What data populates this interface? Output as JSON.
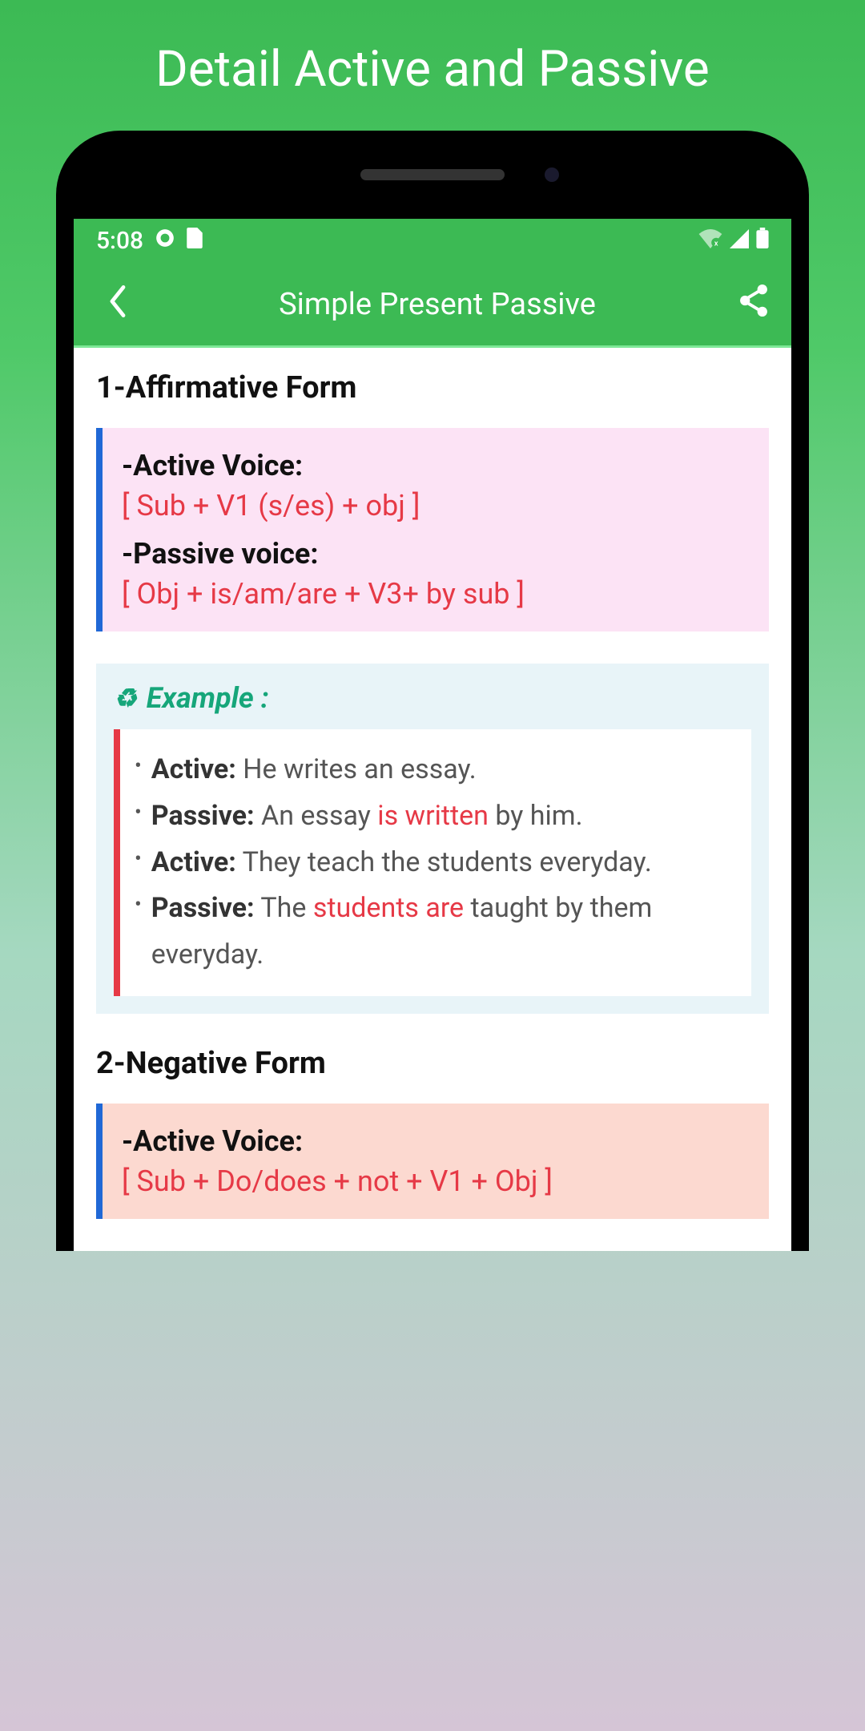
{
  "promo_title": "Detail Active and Passive",
  "status": {
    "time": "5:08"
  },
  "appbar": {
    "title": "Simple Present Passive"
  },
  "section1": {
    "title": "1-Affirmative Form",
    "active_label": "-Active Voice:",
    "active_formula": "[ Sub + V1 (s/es) + obj ]",
    "passive_label": "-Passive voice:",
    "passive_formula": "[ Obj + is/am/are + V3+ by sub ]"
  },
  "example": {
    "header": "Example :",
    "lines": [
      {
        "label": "Active:",
        "prefix": " He writes an essay.",
        "red": "",
        "suffix": ""
      },
      {
        "label": "Passive:",
        "prefix": " An essay ",
        "red": "is written",
        "suffix": " by him."
      },
      {
        "label": "Active:",
        "prefix": " They teach the students everyday.",
        "red": "",
        "suffix": ""
      },
      {
        "label": "Passive:",
        "prefix": " The ",
        "red": "students are",
        "suffix": " taught by them everyday."
      }
    ]
  },
  "section2": {
    "title": "2-Negative Form",
    "active_label": "-Active Voice:",
    "active_formula": "[ Sub + Do/does + not + V1 + Obj  ]"
  }
}
